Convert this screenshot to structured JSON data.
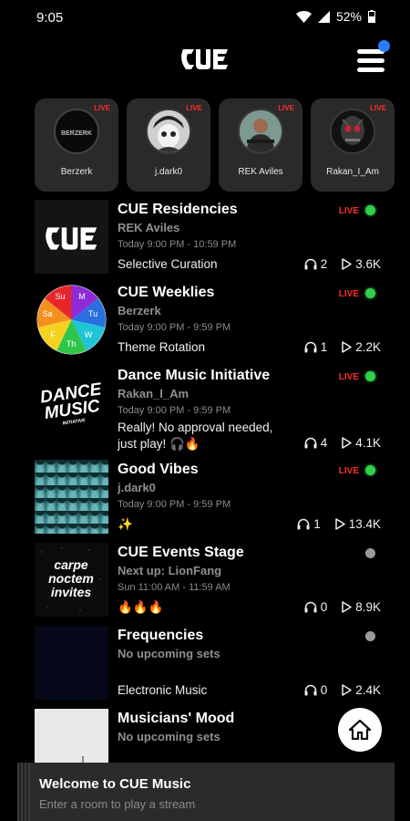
{
  "status": {
    "time": "9:05",
    "battery": "52%"
  },
  "header": {
    "logo": "CUE",
    "menu_icon": "hamburger-icon",
    "notification_color": "#2a7dff"
  },
  "live_users": [
    {
      "name": "Berzerk",
      "badge": "LIVE",
      "avatar_text": "BERZERK"
    },
    {
      "name": "j.dark0",
      "badge": "LIVE"
    },
    {
      "name": "REK Aviles",
      "badge": "LIVE"
    },
    {
      "name": "Rakan_I_Am",
      "badge": "LIVE"
    }
  ],
  "rooms": [
    {
      "title": "CUE Residencies",
      "host": "REK Aviles",
      "time": "Today 9:00 PM - 10:59 PM",
      "desc": "Selective Curation",
      "live": "LIVE",
      "listeners": "2",
      "plays": "3.6K"
    },
    {
      "title": "CUE Weeklies",
      "host": "Berzerk",
      "time": "Today 9:00 PM - 9:59 PM",
      "desc": "Theme Rotation",
      "live": "LIVE",
      "listeners": "1",
      "plays": "2.2K",
      "wheel": [
        "Su",
        "M",
        "Tu",
        "W",
        "Th",
        "F",
        "Sa"
      ]
    },
    {
      "title": "Dance Music Initiative",
      "host": "Rakan_I_Am",
      "time": "Today 9:00 PM - 9:59 PM",
      "desc": "Really! No approval needed, just play! 🎧🔥",
      "live": "LIVE",
      "listeners": "4",
      "plays": "4.1K",
      "thumb_text": [
        "DANCE",
        "MUSIC",
        "INITIATIVE"
      ]
    },
    {
      "title": "Good Vibes",
      "host": "j.dark0",
      "time": "Today 9:00 PM - 9:59 PM",
      "desc": "✨",
      "live": "LIVE",
      "listeners": "1",
      "plays": "13.4K"
    },
    {
      "title": "CUE Events Stage",
      "host": "Next up: LionFang",
      "time": "Sun 11:00 AM - 11:59 AM",
      "desc": "🔥🔥🔥",
      "listeners": "0",
      "plays": "8.9K",
      "thumb_text": [
        "carpe",
        "noctem",
        "invites"
      ]
    },
    {
      "title": "Frequencies",
      "host": "No upcoming sets",
      "time": "",
      "desc": "Electronic Music",
      "listeners": "0",
      "plays": "2.4K"
    },
    {
      "title": "Musicians' Mood",
      "host": "No upcoming sets"
    }
  ],
  "colors": {
    "live_red": "#ff2a2a",
    "live_green": "#2fd14a",
    "offline_grey": "#9a9a9a",
    "card_bg": "#2a2a2a"
  },
  "footer": {
    "title": "Welcome to CUE Music",
    "subtitle": "Enter a room to play a stream"
  },
  "fab": {
    "icon": "home-icon"
  }
}
